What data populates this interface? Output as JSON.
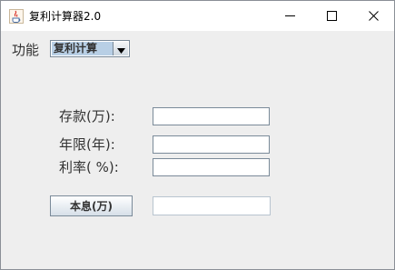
{
  "window": {
    "title": "复利计算器2.0",
    "icon": "java-cup-icon",
    "controls": [
      "minimize-icon",
      "maximize-icon",
      "close-icon"
    ]
  },
  "function_selector": {
    "label": "功能",
    "selected": "复利计算"
  },
  "form": {
    "deposit_label": "存款(万):",
    "deposit_value": "",
    "years_label": "年限(年):",
    "years_value": "",
    "rate_label": "利率( %):",
    "rate_value": ""
  },
  "action": {
    "button_label": "本息(万)",
    "result_value": ""
  },
  "colors": {
    "content_bg": "#eeeeee",
    "combo_selected_bg": "#b8cfe5",
    "border": "#7a8a99",
    "text": "#333333"
  }
}
